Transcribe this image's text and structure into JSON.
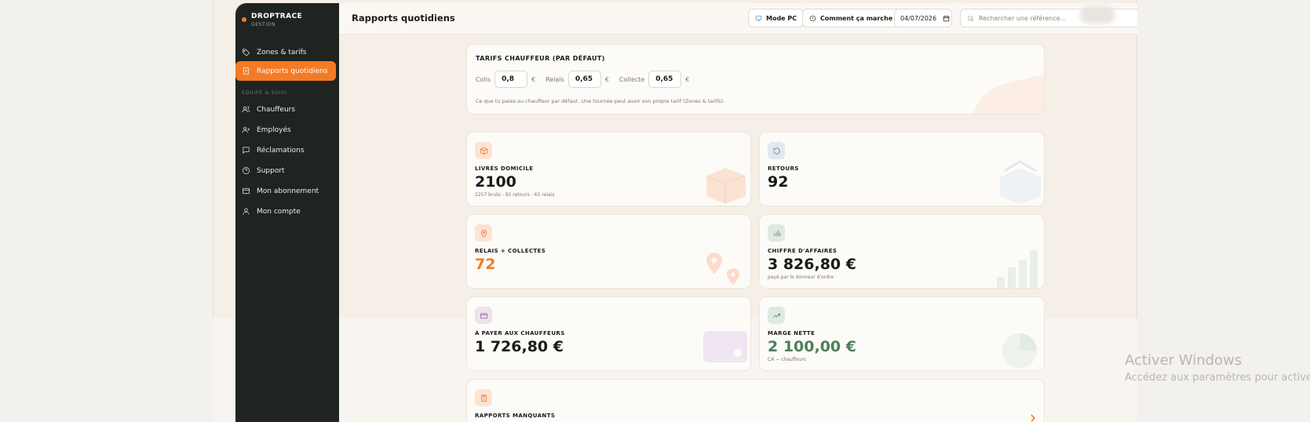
{
  "brand": {
    "name": "DROPTRACE",
    "subtitle": "GESTION",
    "accent": "#f47b25"
  },
  "sidebar": {
    "items": [
      {
        "label": "Zones & tarifs",
        "icon": "tag-icon"
      },
      {
        "label": "Rapports quotidiens",
        "icon": "report-icon",
        "active": true
      },
      {
        "label": "Chauffeurs",
        "icon": "users-icon"
      },
      {
        "label": "Employés",
        "icon": "user-plus-icon"
      },
      {
        "label": "Réclamations",
        "icon": "message-icon"
      },
      {
        "label": "Support",
        "icon": "help-icon"
      },
      {
        "label": "Mon abonnement",
        "icon": "card-icon"
      },
      {
        "label": "Mon compte",
        "icon": "user-icon"
      }
    ],
    "section_label": "ÉQUIPE & SUIVI"
  },
  "header": {
    "title": "Rapports quotidiens",
    "mode_pc": "Mode PC",
    "how_it_works": "Comment ça marche ?",
    "date_value": "04/07/2026",
    "search_placeholder": "Rechercher une référence..."
  },
  "tarifs": {
    "title": "TARIFS CHAUFFEUR (PAR DÉFAUT)",
    "colis_label": "Colis",
    "colis_value": "0,8",
    "relais_label": "Relais",
    "relais_value": "0,65",
    "collecte_label": "Collecte",
    "collecte_value": "0,65",
    "currency": "€",
    "note": "Ce que tu paies au chauffeur par défaut. Une tournée peut avoir son propre tarif (Zones & tarifs)."
  },
  "tiles": {
    "livres": {
      "label": "LIVRÉS DOMICILE",
      "value": "2100",
      "sub": "2257 bruts - 92 retours - 65 relais"
    },
    "retours": {
      "label": "RETOURS",
      "value": "92"
    },
    "relais": {
      "label": "RELAIS + COLLECTES",
      "value": "72"
    },
    "ca": {
      "label": "CHIFFRE D'AFFAIRES",
      "value": "3 826,80 €",
      "sub": "payé par le donneur d'ordre"
    },
    "payer": {
      "label": "À PAYER AUX CHAUFFEURS",
      "value": "1 726,80 €"
    },
    "marge": {
      "label": "MARGE NETTE",
      "value": "2 100,00 €",
      "sub": "CA − chauffeurs"
    },
    "manquants": {
      "label": "RAPPORTS MANQUANTS"
    }
  },
  "windows_watermark": {
    "title": "Activer Windows",
    "subtitle": "Accédez aux paramètres pour activer"
  }
}
